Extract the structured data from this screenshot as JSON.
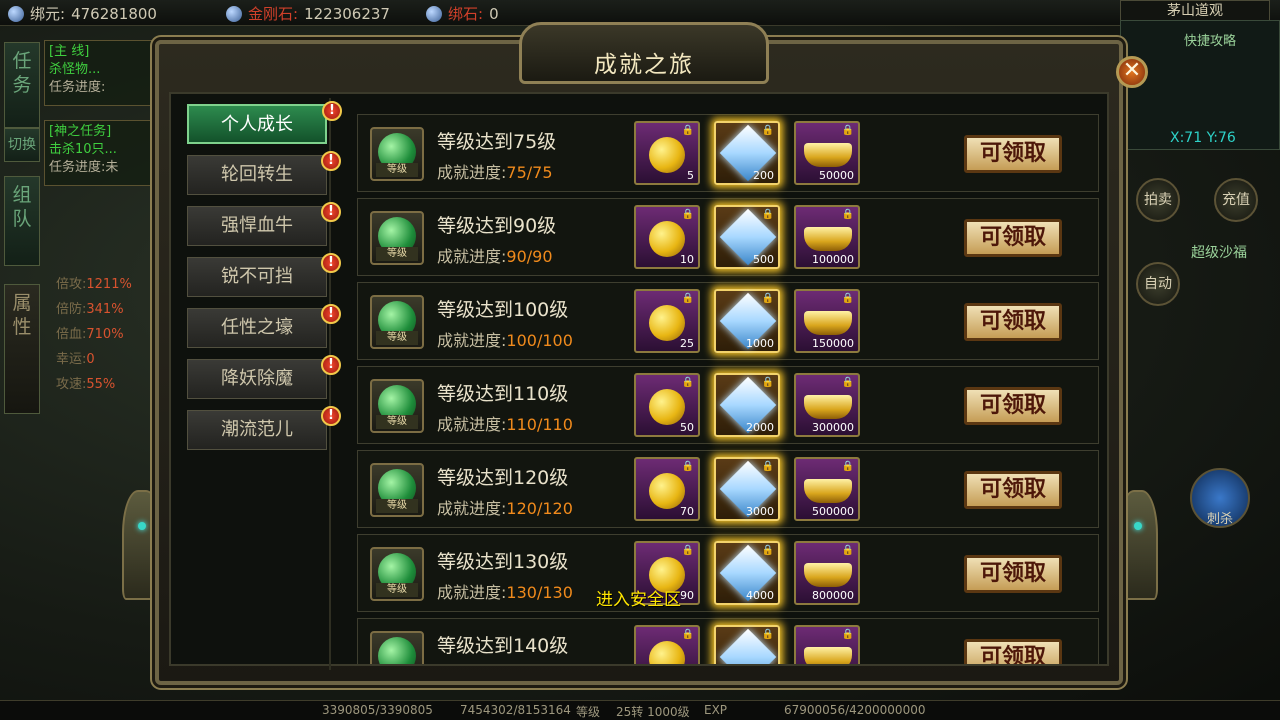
{
  "topbar": {
    "bound_yuan_label": "绑元:",
    "bound_yuan_value": "476281800",
    "diamond_label": "金刚石:",
    "diamond_value": "122306237",
    "bound_stone_label": "绑石:",
    "bound_stone_value": "0",
    "location": "茅山道观"
  },
  "left_side": {
    "tab_task": "任务",
    "tab_switch": "切换",
    "tab_team": "组队",
    "tab_attr": "属性",
    "quest1_tag": "[主 线]",
    "quest1_line": "杀怪物...",
    "quest1_progress": "任务进度:",
    "quest2_tag": "[神之任务]",
    "quest2_line": "击杀10只...",
    "quest2_progress": "任务进度:未",
    "stats": [
      {
        "label": "倍攻:",
        "value": "1211%"
      },
      {
        "label": "倍防:",
        "value": "341%"
      },
      {
        "label": "倍血:",
        "value": "710%"
      },
      {
        "label": "幸运:",
        "value": "0"
      },
      {
        "label": "攻速:",
        "value": "55%"
      }
    ]
  },
  "right_side": {
    "quick_title": "快捷攻略",
    "coords": "X:71 Y:76",
    "btn_auction": "拍卖",
    "btn_recharge": "充值",
    "super_rank": "超级沙福",
    "btn_auto": "自动",
    "skill_label": "刺杀"
  },
  "bottombar": {
    "hp": "3390805/3390805",
    "mp": "7454302/8153164",
    "level_label": "等级",
    "level": "25转 1000级",
    "exp_label": "EXP",
    "exp": "67900056/4200000000"
  },
  "panel": {
    "title": "成就之旅",
    "close": "✕",
    "categories": [
      {
        "label": "个人成长",
        "active": true,
        "alert": "!"
      },
      {
        "label": "轮回转生",
        "active": false,
        "alert": "!"
      },
      {
        "label": "强悍血牛",
        "active": false,
        "alert": "!"
      },
      {
        "label": "锐不可挡",
        "active": false,
        "alert": "!"
      },
      {
        "label": "任性之壕",
        "active": false,
        "alert": "!"
      },
      {
        "label": "降妖除魔",
        "active": false,
        "alert": "!"
      },
      {
        "label": "潮流范儿",
        "active": false,
        "alert": "!"
      }
    ],
    "icon_tag": "等级",
    "progress_label": "成就进度:",
    "claim_label": "可领取",
    "achievements": [
      {
        "title": "等级达到75级",
        "progress": "75/75",
        "rewards": [
          "5",
          "200",
          "50000"
        ]
      },
      {
        "title": "等级达到90级",
        "progress": "90/90",
        "rewards": [
          "10",
          "500",
          "100000"
        ]
      },
      {
        "title": "等级达到100级",
        "progress": "100/100",
        "rewards": [
          "25",
          "1000",
          "150000"
        ]
      },
      {
        "title": "等级达到110级",
        "progress": "110/110",
        "rewards": [
          "50",
          "2000",
          "300000"
        ]
      },
      {
        "title": "等级达到120级",
        "progress": "120/120",
        "rewards": [
          "70",
          "3000",
          "500000"
        ]
      },
      {
        "title": "等级达到130级",
        "progress": "130/130",
        "rewards": [
          "90",
          "4000",
          "800000"
        ]
      },
      {
        "title": "等级达到140级",
        "progress": "",
        "rewards": [
          "",
          "",
          ""
        ]
      }
    ],
    "reward_icons": [
      "gold-coin-icon",
      "diamond-icon",
      "gold-ingot-icon"
    ],
    "lock_glyph": "🔒",
    "notice": "进入安全区"
  }
}
